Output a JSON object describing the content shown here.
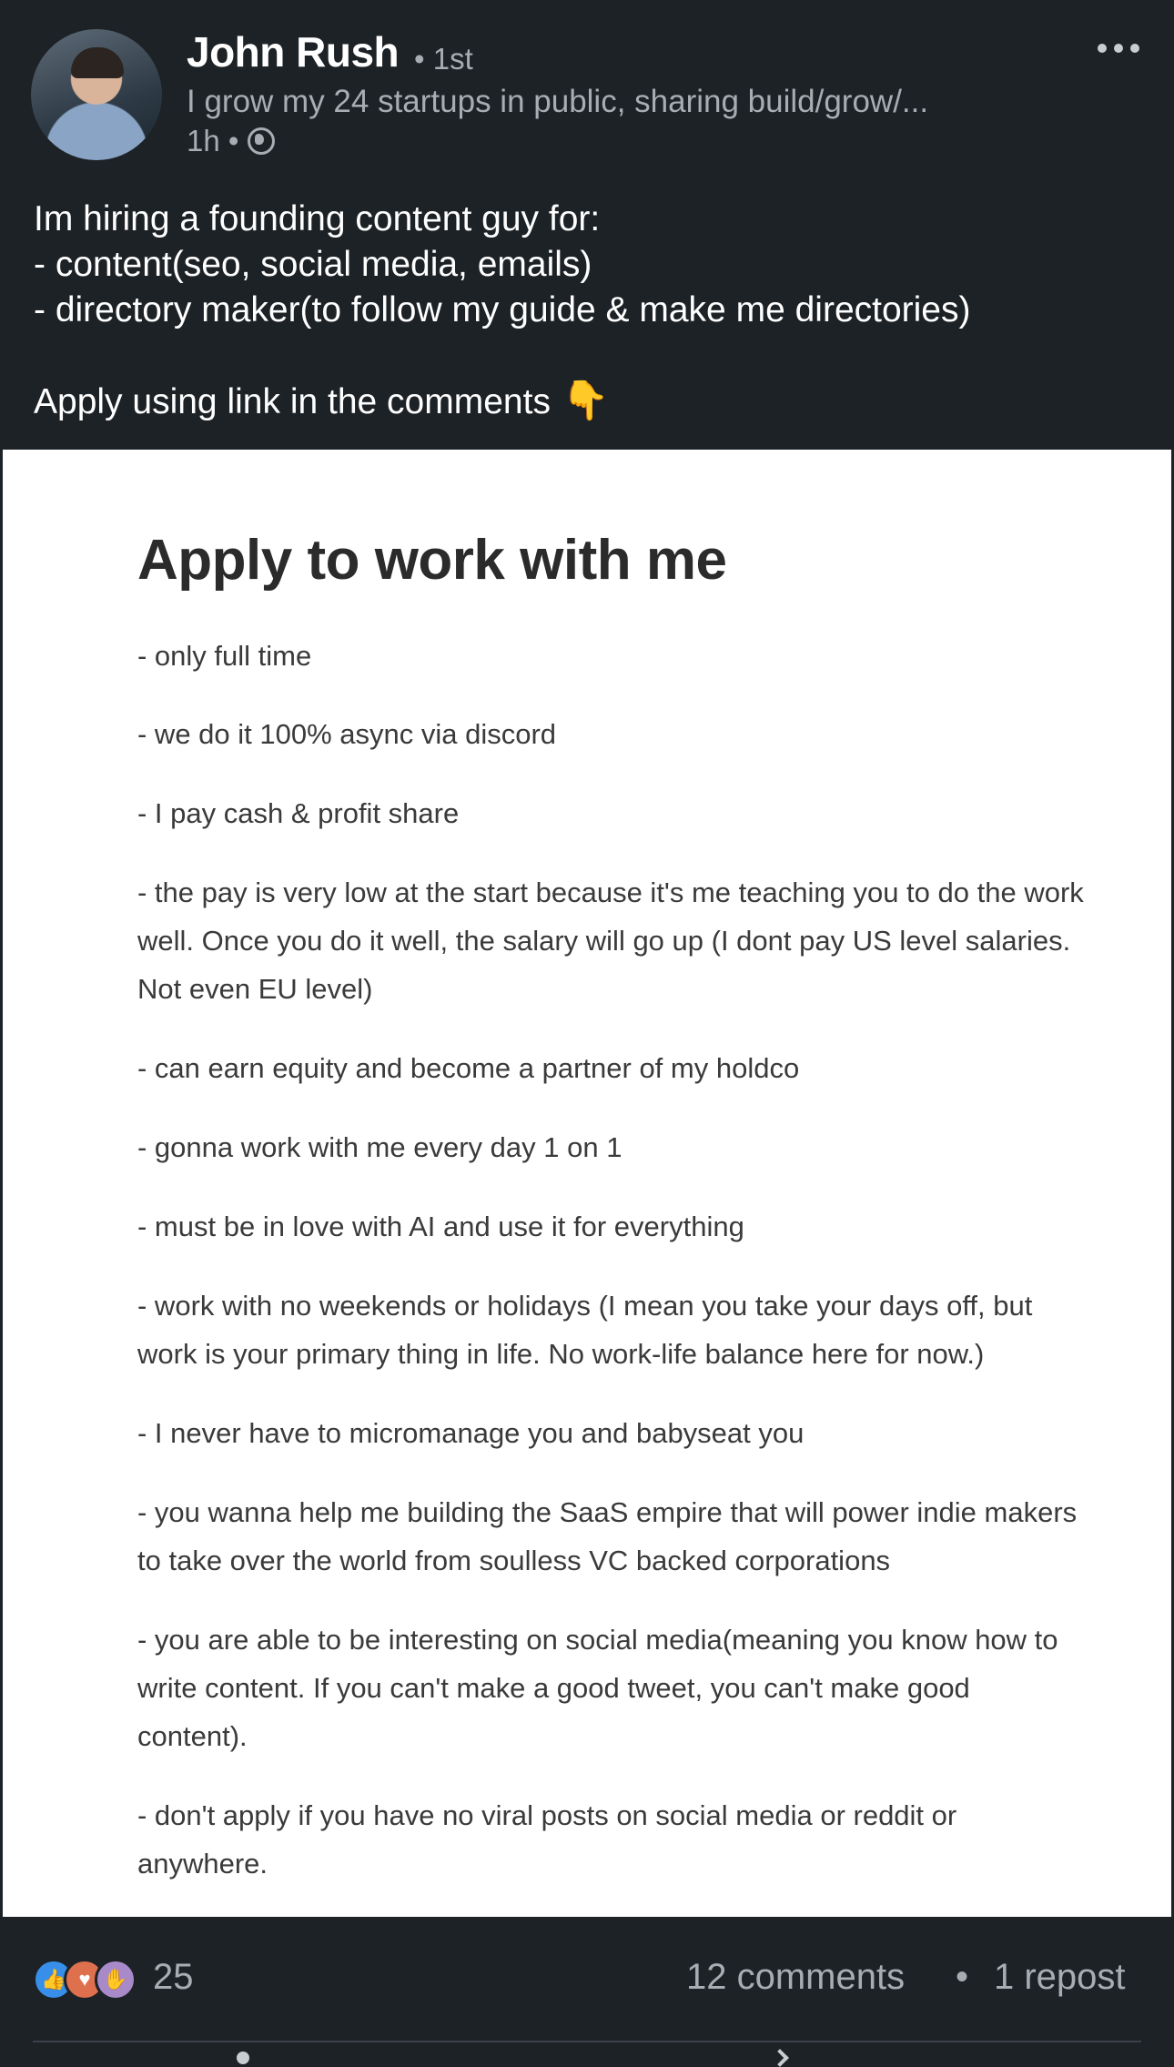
{
  "author": {
    "name": "John Rush",
    "degree": "• 1st",
    "headline": "I grow my 24 startups in public, sharing build/grow/...",
    "time": "1h •"
  },
  "post": {
    "lines": [
      "Im hiring a founding content guy for:",
      "- content(seo, social media, emails)",
      "- directory maker(to follow my guide & make me directories)"
    ],
    "cta": "Apply using link in the comments",
    "cta_emoji": "👇"
  },
  "image": {
    "title": "Apply to work with me",
    "items": [
      "- only full time",
      "- we do it 100% async via discord",
      "- I pay cash & profit share",
      "- the pay is very low at the start because it's me teaching you to do the work well. Once you do it well, the salary will go up (I dont pay US level salaries. Not even EU level)",
      "- can earn equity and become a partner of my holdco",
      "- gonna work with me every day 1 on 1",
      "- must be in love with AI and use it for everything",
      "- work with no weekends or holidays (I mean you take your days off, but work is your primary thing in life. No work-life balance here for now.)",
      "- I never have to micromanage you and babyseat you",
      "- you wanna help me building the SaaS empire that will power indie makers to take over the world from soulless VC backed corporations",
      "- you are able to be interesting on social media(meaning you know how to write content. If you can't make a good tweet, you can't make good content).",
      "- don't apply if you have no viral posts on social media or reddit or anywhere."
    ]
  },
  "social": {
    "reactions_count": "25",
    "comments": "12 comments",
    "separator": "•",
    "reposts": "1 repost",
    "reaction_icons": [
      "like-icon",
      "love-icon",
      "support-icon"
    ]
  },
  "colors": {
    "background": "#1d2226",
    "secondary_text": "#a8adb3",
    "like": "#378fe9",
    "love": "#df704d",
    "support": "#a88ac9"
  }
}
